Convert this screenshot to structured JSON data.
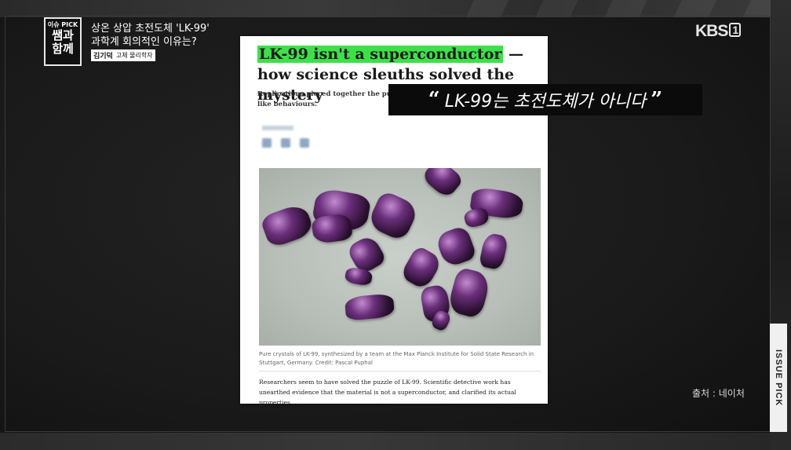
{
  "program": {
    "badge": "이슈 PICK",
    "name_line1": "쌤과",
    "name_line2": "함께"
  },
  "headline": {
    "line1": "상온 상압 초전도체 'LK-99'",
    "line2": "과학계 회의적인 이유는?"
  },
  "speaker": {
    "name": "김기덕",
    "role": "고체 물리학자"
  },
  "broadcaster": {
    "name": "KBS",
    "channel": "1"
  },
  "article": {
    "title_highlight": "LK-99 isn't a superconductor",
    "title_rest": " — how science sleuths solved the mystery",
    "subtitle": "Replications pieced together the puzzle o",
    "subtitle_line2": "like behaviours.",
    "caption": "Pure crystals of LK-99, synthesized by a team at the Max Planck Institute for Solid State Research in Stuttgart, Germany. Credit: Pascal Puphal",
    "body": "Researchers seem to have solved the puzzle of LK-99. Scientific detective work has unearthed evidence that the material is not a superconductor, and clarified its actual properties.",
    "highlight_color": "#3ee04a"
  },
  "quote": {
    "open": "“",
    "text": "LK-99는 초전도체가 아니다",
    "close": "”"
  },
  "source": "출처 : 네이처",
  "side_label": "ISSUE PICK"
}
